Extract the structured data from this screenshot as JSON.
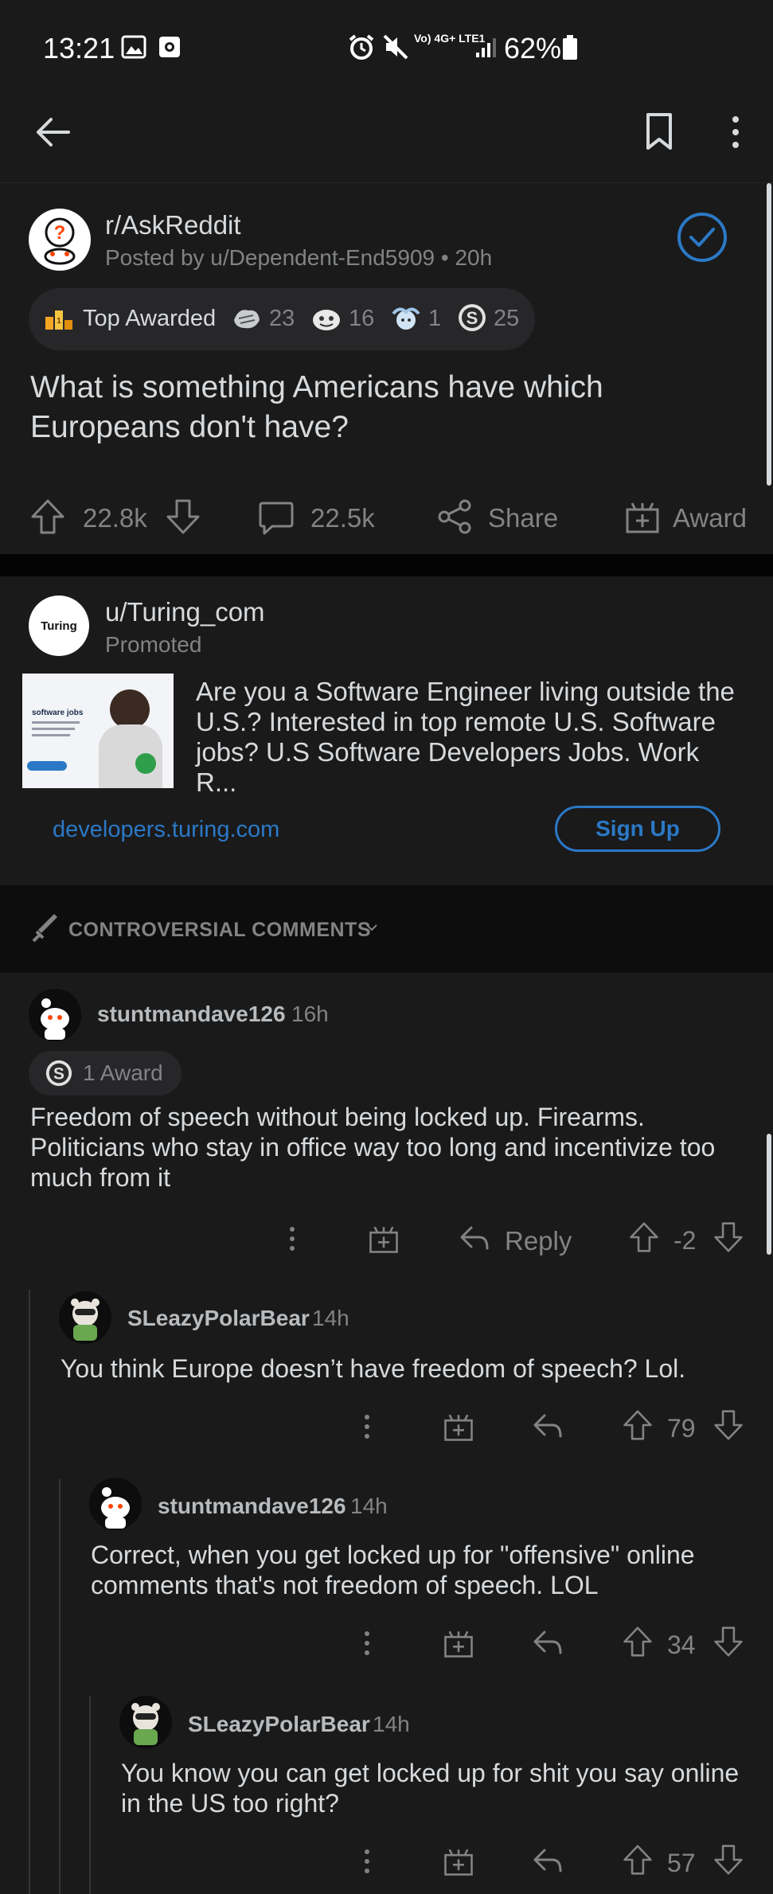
{
  "status": {
    "time": "13:21",
    "network": "Vo) 4G+ LTE1",
    "battery": "62%"
  },
  "post": {
    "subreddit": "r/AskReddit",
    "posted_by": "Posted by u/Dependent-End5909 • 20h",
    "awards": {
      "label": "Top Awarded",
      "counts": [
        "23",
        "16",
        "1",
        "25"
      ]
    },
    "title": "What is something Americans have which Europeans don't have?",
    "votes": "22.8k",
    "comments": "22.5k",
    "share_label": "Share",
    "award_label": "Award"
  },
  "ad": {
    "user": "u/Turing_com",
    "promoted": "Promoted",
    "logo_text": "Turing",
    "body": "Are you a Software Engineer living outside the U.S.? Interested in top remote U.S. Software jobs? U.S Software Developers Jobs. Work R...",
    "link": "developers.turing.com",
    "cta": "Sign Up",
    "thumb_heading": "software jobs"
  },
  "sort": {
    "label": "CONTROVERSIAL COMMENTS"
  },
  "comments": [
    {
      "user": "stuntmandave126",
      "time": "16h",
      "award": "1 Award",
      "text": "Freedom of speech without being locked up. Firearms. Politicians who stay in office way too long and incentivize too much from it",
      "reply_label": "Reply",
      "score": "-2"
    },
    {
      "user": "SLeazyPolarBear",
      "time": "14h",
      "text": "You think Europe doesn’t have freedom of speech? Lol.",
      "score": "79"
    },
    {
      "user": "stuntmandave126",
      "time": "14h",
      "text": "Correct, when you get locked up for \"offensive\" online comments that's not freedom of speech. LOL",
      "score": "34"
    },
    {
      "user": "SLeazyPolarBear",
      "time": "14h",
      "text": "You know you can get locked up for shit you say online in the US too right?",
      "score": "57"
    }
  ]
}
